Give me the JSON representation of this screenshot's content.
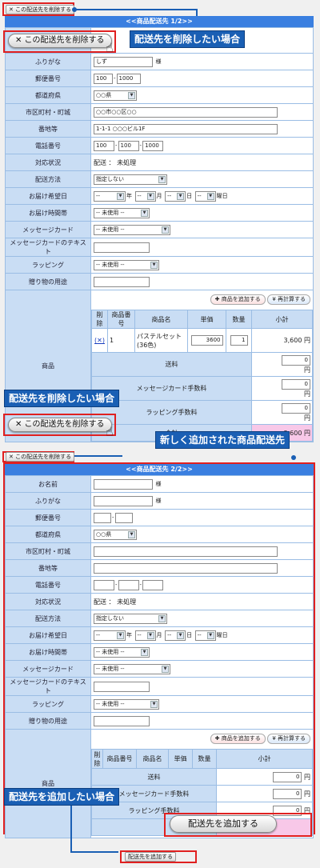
{
  "colors": {
    "header": "#3a7fe0",
    "label_bg": "#c9ddf4",
    "callout": "#1a5fb4",
    "highlight": "#e02020",
    "subtotal": "#f8c8e8"
  },
  "top_delete_button": {
    "label": "✕ この配送先を削除する"
  },
  "callouts": {
    "delete_case": "配送先を削除したい場合",
    "new_section": "新しく追加された商品配送先",
    "add_case": "配送先を追加したい場合"
  },
  "zoom_delete_button": {
    "label": "✕ この配送先を削除する"
  },
  "zoom_add_button": {
    "label": "配送先を追加する"
  },
  "bottom_add_button": {
    "label": "配送先を追加する"
  },
  "section1": {
    "title": "<<商品配送先 1/2>>",
    "furigana_label": "ふりがな",
    "furigana_value": "しず",
    "sama": "様",
    "zip_label": "郵便番号",
    "zip1": "100",
    "zip2": "1000",
    "pref_label": "都道府県",
    "pref_value": "○○県",
    "city_label": "市区町村・町城",
    "city_value": "○○市○○区○○",
    "addr_label": "番地等",
    "addr_value": "1-1-1 ○○○ビル1F",
    "tel_label": "電話番号",
    "tel1": "100",
    "tel2": "100",
    "tel3": "1000",
    "status_label": "対応状況",
    "status_value": "配送 ： 未処理",
    "ship_label": "配送方法",
    "ship_value": "指定しない",
    "date_label": "お届け希望日",
    "dash": "--",
    "year": "年",
    "month": "月",
    "day": "日",
    "weekday": "曜日",
    "time_label": "お届け時間帯",
    "unused": "-- 未使用 --",
    "card_label": "メッセージカード",
    "cardtext_label": "メッセージカードのテキスト",
    "wrap_label": "ラッピング",
    "gift_label": "贈り物の用途",
    "product_label": "商品",
    "add_product": "商品を追加する",
    "recalc": "再計算する",
    "headers": {
      "del": "削除",
      "code": "商品番号",
      "name": "商品名",
      "price": "単価",
      "qty": "数量",
      "subtotal": "小計"
    },
    "item": {
      "del": "(✕)",
      "code": "1",
      "name": "パステルセット(36色)",
      "price": "3600",
      "qty": "1",
      "subtotal": "3,600 円"
    },
    "shipping_label": "送料",
    "shipping_value": "0",
    "yen": "円",
    "cardfee_label": "メッセージカード手数料",
    "cardfee_value": "0",
    "wrapfee_label": "ラッピング手数料",
    "wrapfee_value": "0",
    "total_label": "合計",
    "total_value": "3,600 円"
  },
  "section2": {
    "title": "<<商品配送先 2/2>>",
    "name_label": "お名前",
    "sama": "様",
    "furigana_label": "ふりがな",
    "zip_label": "郵便番号",
    "pref_label": "都道府県",
    "pref_value": "○○県",
    "city_label": "市区町村・町城",
    "addr_label": "番地等",
    "tel_label": "電話番号",
    "status_label": "対応状況",
    "status_value": "配送 ： 未処理",
    "ship_label": "配送方法",
    "ship_value": "指定しない",
    "date_label": "お届け希望日",
    "dash": "--",
    "year": "年",
    "month": "月",
    "day": "日",
    "weekday": "曜日",
    "time_label": "お届け時間帯",
    "unused": "-- 未使用 --",
    "card_label": "メッセージカード",
    "cardtext_label": "メッセージカードのテキスト",
    "wrap_label": "ラッピング",
    "gift_label": "贈り物の用途",
    "product_label": "商品",
    "add_product": "商品を追加する",
    "recalc": "再計算する",
    "headers": {
      "del": "削除",
      "code": "商品番号",
      "name": "商品名",
      "price": "単価",
      "qty": "数量",
      "subtotal": "小計"
    },
    "shipping_label": "送料",
    "shipping_value": "0",
    "yen": "円",
    "cardfee_label": "メッセージカード手数料",
    "cardfee_value": "0",
    "wrapfee_label": "ラッピング手数料",
    "wrapfee_value": "0"
  }
}
